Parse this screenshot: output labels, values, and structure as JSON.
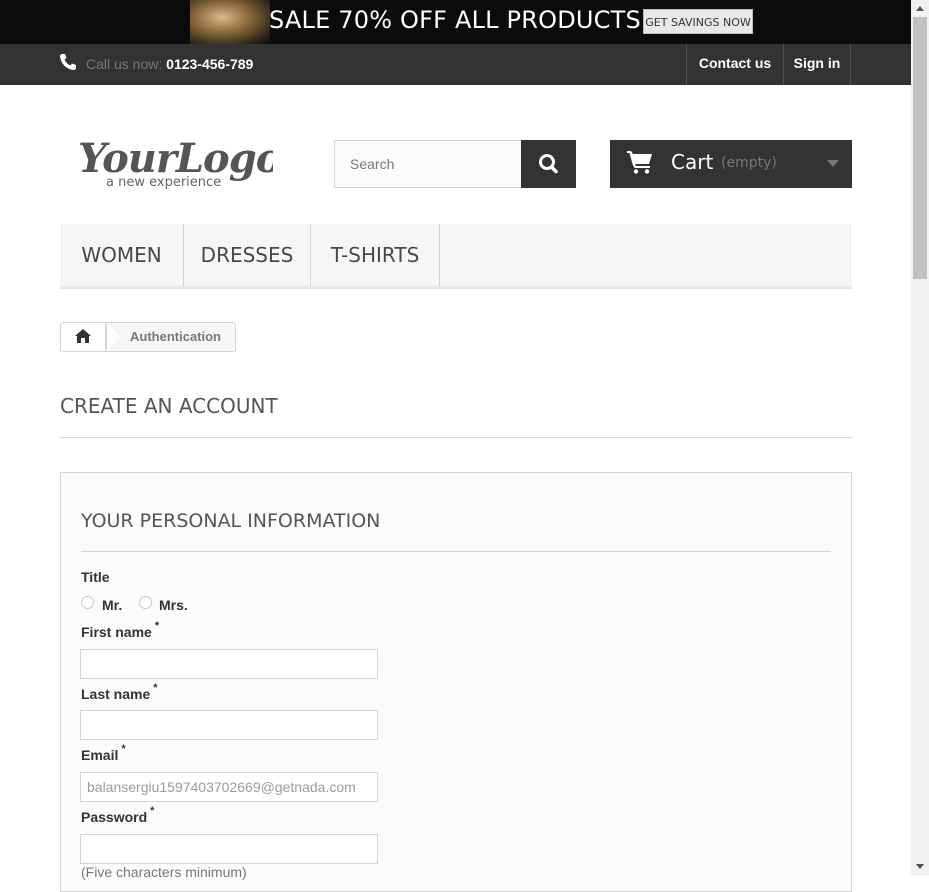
{
  "banner": {
    "headline": "SALE 70% OFF ALL PRODUCTS",
    "cta_label": "GET SAVINGS NOW"
  },
  "topbar": {
    "call_prefix": "Call us now: ",
    "phone": "0123-456-789",
    "contact_label": "Contact us",
    "signin_label": "Sign in"
  },
  "header": {
    "logo_text": "YourLogo",
    "logo_tagline": "a new experience",
    "search_placeholder": "Search",
    "cart_label": "Cart",
    "cart_status": "(empty)"
  },
  "menu": {
    "items": [
      {
        "label": "WOMEN"
      },
      {
        "label": "DRESSES"
      },
      {
        "label": "T-SHIRTS"
      }
    ]
  },
  "breadcrumb": {
    "current": "Authentication"
  },
  "page": {
    "title": "CREATE AN ACCOUNT",
    "section_title": "YOUR PERSONAL INFORMATION"
  },
  "form": {
    "title_label": "Title",
    "title_options": [
      "Mr.",
      "Mrs."
    ],
    "first_name_label": "First name",
    "last_name_label": "Last name",
    "email_label": "Email",
    "email_value": "balansergiu1597403702669@getnada.com",
    "password_label": "Password",
    "password_hint": "(Five characters minimum)",
    "required_mark": "*"
  },
  "colors": {
    "topbar": "#333333",
    "banner": "#0b0b0b",
    "menu_bg": "#f6f6f6",
    "form_bg": "#fbfbfb"
  },
  "icons": [
    "phone-icon",
    "search-icon",
    "cart-icon",
    "chevron-down-icon",
    "home-icon"
  ]
}
